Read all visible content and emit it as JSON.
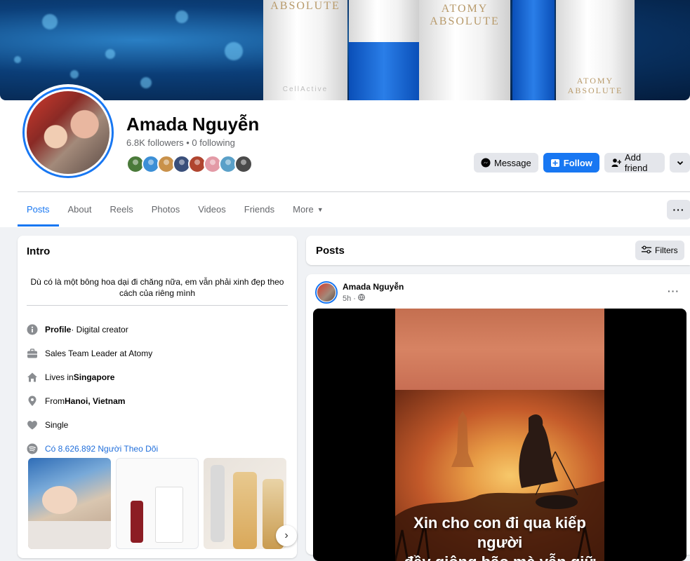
{
  "profile": {
    "name": "Amada Nguyễn",
    "stats": "6.8K followers • 0 following",
    "friend_avatar_colors": [
      "#4a7a3a",
      "#3c8fd6",
      "#c9914a",
      "#3a4f7a",
      "#b0452f",
      "#e39aa6",
      "#5aa0c8",
      "#4a4a4a"
    ]
  },
  "cover": {
    "brand_1": "ABSOLUTE",
    "brand_2a": "ATOMY",
    "brand_2b": "ABSOLUTE",
    "brand_3a": "ATOMY",
    "brand_3b": "ABSOLUTE",
    "cell_label": "CellActive"
  },
  "actions": {
    "message": "Message",
    "follow": "Follow",
    "add_friend": "Add friend"
  },
  "tabs": [
    "Posts",
    "About",
    "Reels",
    "Photos",
    "Videos",
    "Friends",
    "More"
  ],
  "intro": {
    "title": "Intro",
    "bio": "Dù có là một bông hoa dại đi chăng nữa, em vẫn phải xinh đẹp theo cách của riêng mình",
    "profile_label": "Profile",
    "profile_value": " · Digital creator",
    "work": "Sales Team Leader at Atomy",
    "lives_prefix": "Lives in ",
    "lives_value": "Singapore",
    "from_prefix": "From ",
    "from_value": "Hanoi, Vietnam",
    "relationship": "Single",
    "followers_link": "Có 8.626.892 Người Theo Dõi"
  },
  "posts_header": {
    "title": "Posts",
    "filters": "Filters"
  },
  "post": {
    "author": "Amada Nguyễn",
    "time": "5h ·",
    "caption_line1": "Xin cho con đi qua kiếp người",
    "caption_line2": "đầy giông bão mà vẫn giữ"
  },
  "colors": {
    "accent": "#1877f2",
    "link": "#216fdb",
    "secondary_text": "#65676b"
  }
}
